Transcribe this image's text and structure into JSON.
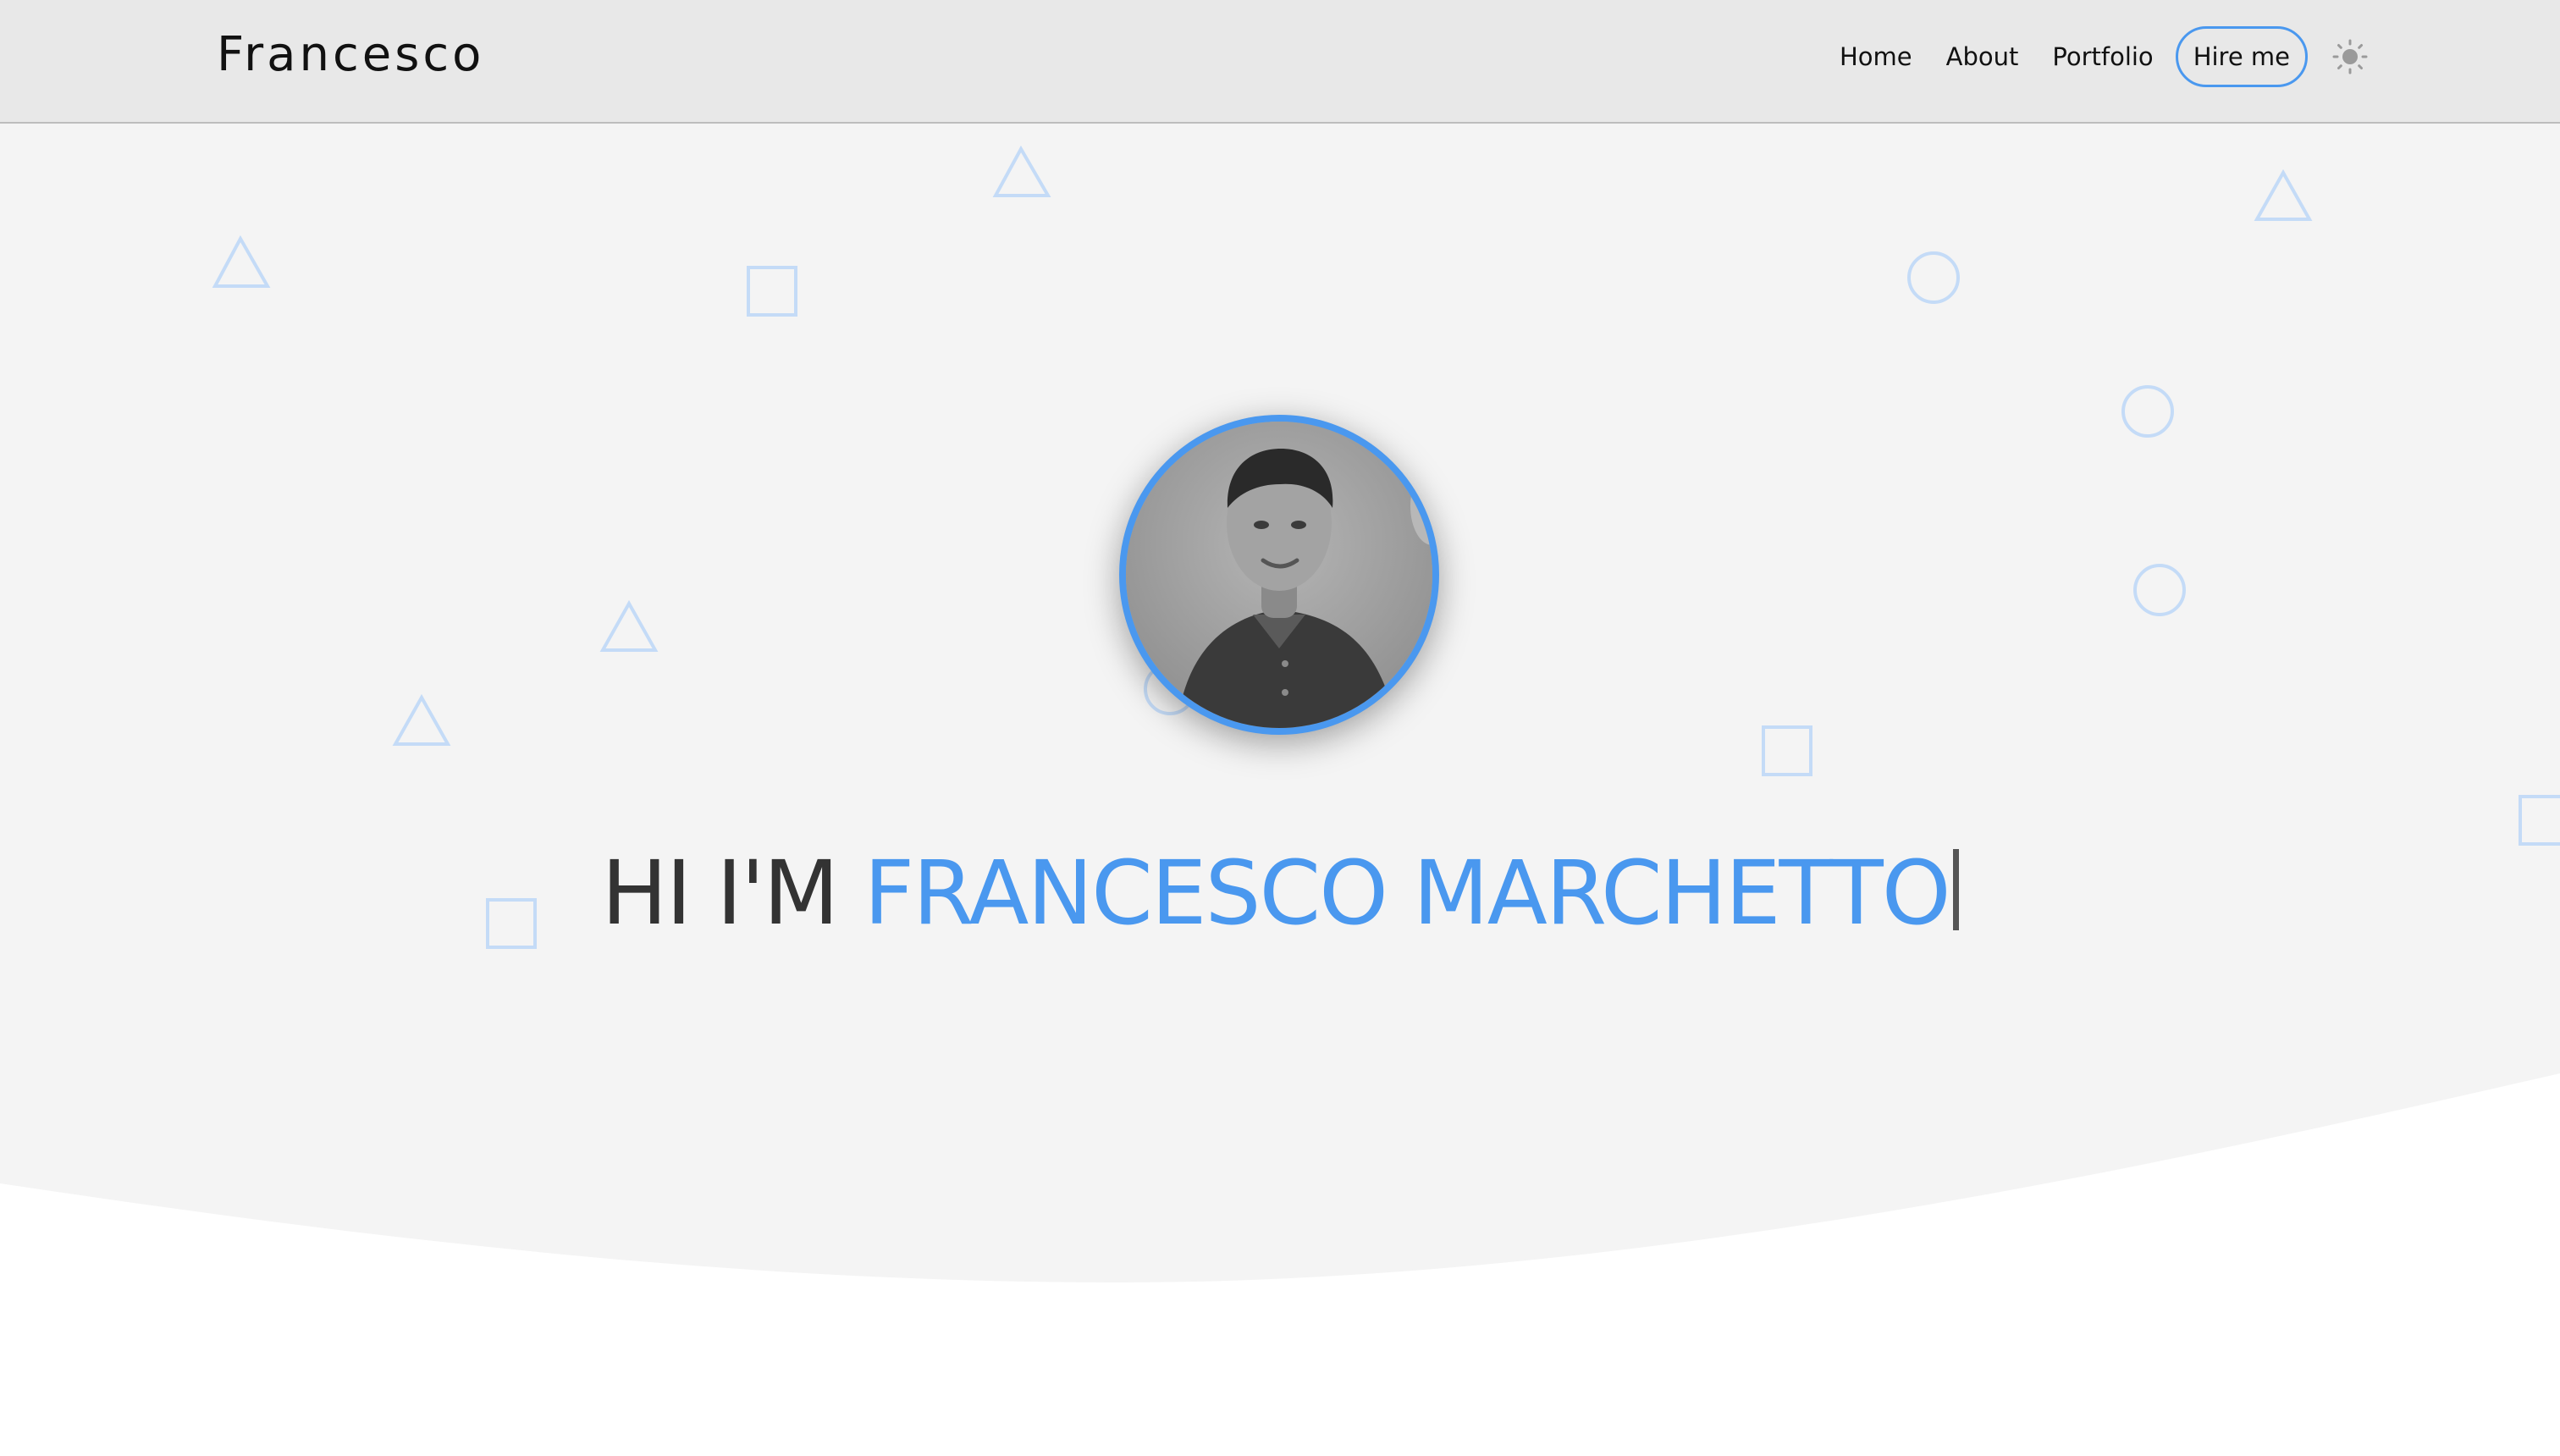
{
  "colors": {
    "accent": "#4a98ef",
    "navbar_bg": "#e8e8e8",
    "hero_bg": "#f4f4f4",
    "text_dark": "#333333"
  },
  "navbar": {
    "brand": "Francesco",
    "links": [
      "Home",
      "About",
      "Portfolio"
    ],
    "hire_label": "Hire me",
    "theme_icon": "sun-icon"
  },
  "hero": {
    "greeting": "HI I'M",
    "name": "FRANCESCO MARCHETTO",
    "avatar_icon": "profile-photo"
  }
}
